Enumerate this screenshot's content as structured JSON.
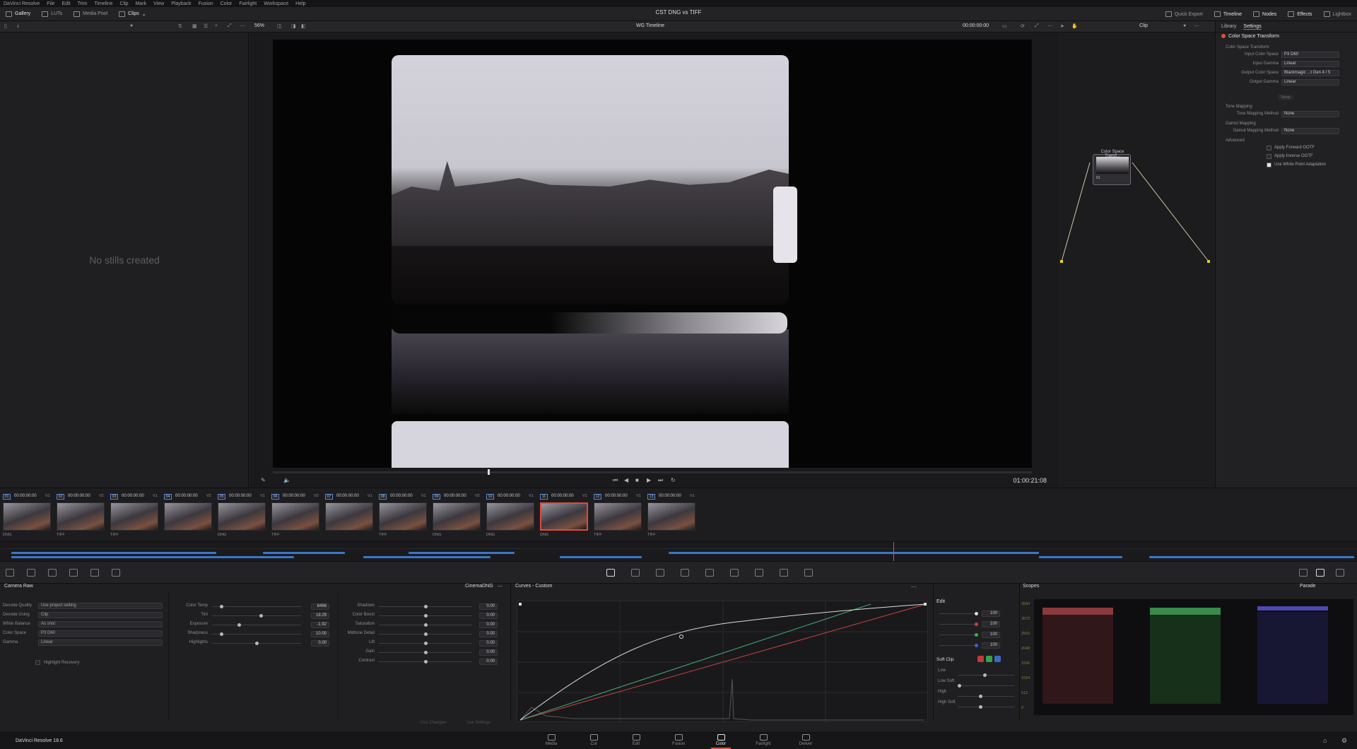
{
  "menu": [
    "DaVinci Resolve",
    "File",
    "Edit",
    "Trim",
    "Timeline",
    "Clip",
    "Mark",
    "View",
    "Playback",
    "Fusion",
    "Color",
    "Fairlight",
    "Workspace",
    "Help"
  ],
  "topbar": {
    "gallery": "Gallery",
    "luts": "LUTs",
    "media_pool": "Media Pool",
    "clips": "Clips",
    "project_title": "CST DNG vs TIFF",
    "quick_export": "Quick Export",
    "timeline": "Timeline",
    "nodes": "Nodes",
    "effects": "Effects",
    "lightbox": "Lightbox"
  },
  "toolbar": {
    "zoom": "56%",
    "timeline_name": "WG Timeline",
    "timecode": "00:00:00:00",
    "clip_mode": "Clip"
  },
  "gallery": {
    "empty": "No stills created"
  },
  "viewer": {
    "current_tc": "01:00:21:08"
  },
  "node": {
    "label": "Color Space Transf...",
    "num": "01"
  },
  "inspector": {
    "tabs": [
      "Library",
      "Settings"
    ],
    "fx_name": "Color Space Transform",
    "section_cst": "Color Space Transform",
    "rows": [
      {
        "label": "Input Color Space",
        "value": "P3 D60"
      },
      {
        "label": "Input Gamma",
        "value": "Linear"
      },
      {
        "label": "Output Color Space",
        "value": "Blackmagic ...t Gen 4 / 5"
      },
      {
        "label": "Output Gamma",
        "value": "Linear"
      }
    ],
    "swap": "Swap",
    "section_tone": "Tone Mapping",
    "tone_label": "Tone Mapping Method",
    "tone_value": "None",
    "section_gamut": "Gamut Mapping",
    "gamut_label": "Gamut Mapping Method",
    "gamut_value": "None",
    "section_adv": "Advanced",
    "checks": [
      {
        "label": "Apply Forward OOTF",
        "checked": false
      },
      {
        "label": "Apply Inverse OOTF",
        "checked": false
      },
      {
        "label": "Use White Point Adaptation",
        "checked": true
      }
    ]
  },
  "clips": [
    {
      "num": "01",
      "tc": "00:00:00:00",
      "track": "V1",
      "fmt": "DNG"
    },
    {
      "num": "02",
      "tc": "00:00:00:00",
      "track": "V2",
      "fmt": "TIFF"
    },
    {
      "num": "03",
      "tc": "00:00:00:00",
      "track": "V1",
      "fmt": "TIFF"
    },
    {
      "num": "04",
      "tc": "00:00:00:00",
      "track": "V2",
      "fmt": ""
    },
    {
      "num": "05",
      "tc": "00:00:00:00",
      "track": "V1",
      "fmt": "DNG"
    },
    {
      "num": "06",
      "tc": "00:00:00:00",
      "track": "V2",
      "fmt": "TIFF"
    },
    {
      "num": "07",
      "tc": "00:00:00:00",
      "track": "V1",
      "fmt": ""
    },
    {
      "num": "08",
      "tc": "00:00:00:00",
      "track": "V1",
      "fmt": "TIFF"
    },
    {
      "num": "09",
      "tc": "00:00:00:00",
      "track": "V2",
      "fmt": "DNG"
    },
    {
      "num": "10",
      "tc": "00:00:00:00",
      "track": "V1",
      "fmt": "DNG"
    },
    {
      "num": "11",
      "tc": "00:00:00:00",
      "track": "V1",
      "fmt": "DNG"
    },
    {
      "num": "12",
      "tc": "00:00:00:00",
      "track": "V1",
      "fmt": "TIFF"
    },
    {
      "num": "13",
      "tc": "00:00:00:00",
      "track": "V1",
      "fmt": "TIFF"
    }
  ],
  "camera_raw": {
    "title": "Camera Raw",
    "format": "CinemaDNG",
    "left": [
      {
        "label": "Decode Quality",
        "value": "Use project setting"
      },
      {
        "label": "Decode Using",
        "value": "Clip"
      },
      {
        "label": "White Balance",
        "value": "As shot"
      },
      {
        "label": "Color Space",
        "value": "P3 D60"
      },
      {
        "label": "Gamma",
        "value": "Linear"
      }
    ],
    "highlight_recovery": "Highlight Recovery",
    "mid": [
      {
        "label": "Color Temp",
        "value": "6466",
        "pos": 0.1
      },
      {
        "label": "Tint",
        "value": "18.29",
        "pos": 0.55
      },
      {
        "label": "Exposure",
        "value": "-1.92",
        "pos": 0.3
      },
      {
        "label": "Sharpness",
        "value": "10.00",
        "pos": 0.1
      },
      {
        "label": "Highlights",
        "value": "0.00",
        "pos": 0.5
      }
    ],
    "right": [
      {
        "label": "Shadows",
        "value": "0.00"
      },
      {
        "label": "Color Boost",
        "value": "0.00"
      },
      {
        "label": "Saturation",
        "value": "0.00"
      },
      {
        "label": "Midtone Detail",
        "value": "0.00"
      },
      {
        "label": "Lift",
        "value": "0.00"
      },
      {
        "label": "Gain",
        "value": "0.00"
      },
      {
        "label": "Contrast",
        "value": "0.00"
      }
    ],
    "use_changes": "Use Changes",
    "use_settings": "Use Settings"
  },
  "curves": {
    "title": "Curves - Custom"
  },
  "edit": {
    "title": "Edit",
    "values": [
      "100",
      "100",
      "100",
      "100"
    ],
    "soft_clip": "Soft Clip",
    "sc_rows": [
      "Low",
      "Low Soft",
      "High",
      "High Soft"
    ]
  },
  "scopes": {
    "title": "Scopes",
    "mode": "Parade",
    "ticks": [
      "3584",
      "3072",
      "2560",
      "2048",
      "1536",
      "1024",
      "512",
      "0"
    ]
  },
  "footer": {
    "app": "DaVinci Resolve 18.6",
    "pages": [
      "Media",
      "Cut",
      "Edit",
      "Fusion",
      "Color",
      "Fairlight",
      "Deliver"
    ],
    "active": "Color"
  }
}
